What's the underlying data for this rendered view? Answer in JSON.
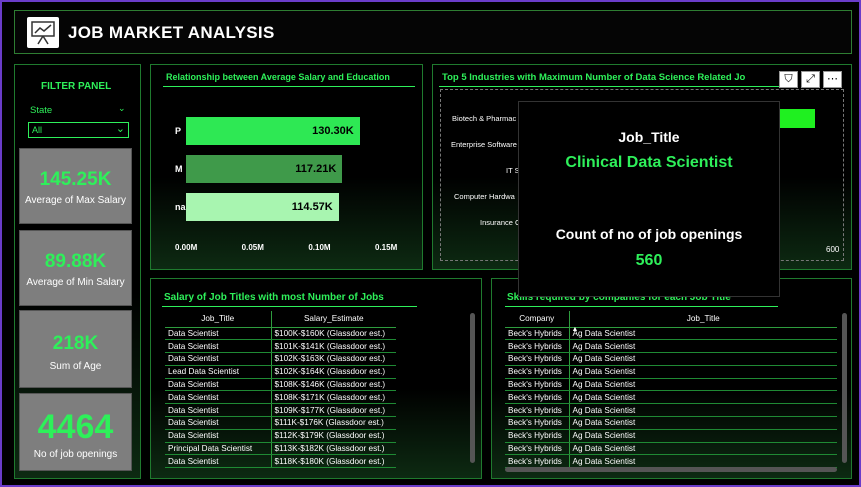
{
  "header": {
    "title": "JOB MARKET ANALYSIS",
    "logo_icon": "analytics-presentation-icon"
  },
  "filter": {
    "title": "FILTER PANEL",
    "state_label": "State",
    "state_value": "All"
  },
  "cards": [
    {
      "value": "145.25K",
      "label": "Average of Max Salary"
    },
    {
      "value": "89.88K",
      "label": "Average of Min Salary"
    },
    {
      "value": "218K",
      "label": "Sum of Age"
    },
    {
      "value": "4464",
      "label": "No of job openings"
    }
  ],
  "salary_edu": {
    "title": "Relationship between Average Salary and Education"
  },
  "chart_data": {
    "type": "bar",
    "orientation": "horizontal",
    "title": "Relationship between Average Salary and Education",
    "categories": [
      "P",
      "M",
      "na"
    ],
    "values": [
      130300,
      117210,
      114570
    ],
    "data_labels": [
      "130.30K",
      "117.21K",
      "114.57K"
    ],
    "xlim": [
      0,
      150000
    ],
    "x_ticks": [
      "0.00M",
      "0.05M",
      "0.10M",
      "0.15M"
    ],
    "colors": [
      "#2ee854",
      "#3f9a4a",
      "#a8f5b0"
    ]
  },
  "industries": {
    "title": "Top 5 Industries with Maximum Number of Data Science Related Jo",
    "labels": [
      "Biotech & Pharmac",
      "Enterprise Software",
      "IT S",
      "Computer Hardwa",
      "Insurance C"
    ],
    "axis_max": "600"
  },
  "tooltip": {
    "key1": "Job_Title",
    "val1": "Clinical Data Scientist",
    "key2": "Count of no of job openings",
    "val2": "560"
  },
  "salary_table": {
    "title": "Salary of Job Titles with most Number of Jobs",
    "columns": [
      "Job_Title",
      "Salary_Estimate"
    ],
    "rows": [
      [
        "Data Scientist",
        "$100K-$160K (Glassdoor est.)"
      ],
      [
        "Data Scientist",
        "$101K-$141K (Glassdoor est.)"
      ],
      [
        "Data Scientist",
        "$102K-$163K (Glassdoor est.)"
      ],
      [
        "Lead Data Scientist",
        "$102K-$164K (Glassdoor est.)"
      ],
      [
        "Data Scientist",
        "$108K-$146K (Glassdoor est.)"
      ],
      [
        "Data Scientist",
        "$108K-$171K (Glassdoor est.)"
      ],
      [
        "Data Scientist",
        "$109K-$177K (Glassdoor est.)"
      ],
      [
        "Data Scientist",
        "$111K-$176K (Glassdoor est.)"
      ],
      [
        "Data Scientist",
        "$112K-$179K (Glassdoor est.)"
      ],
      [
        "Principal Data Scientist",
        "$113K-$182K (Glassdoor est.)"
      ],
      [
        "Data Scientist",
        "$118K-$180K (Glassdoor est.)"
      ]
    ]
  },
  "skills_table": {
    "title": "Skills required by companies for each Job Title",
    "columns": [
      "Company",
      "Job_Title"
    ],
    "rows": [
      [
        "Beck's Hybrids",
        "Ag Data Scientist"
      ],
      [
        "Beck's Hybrids",
        "Ag Data Scientist"
      ],
      [
        "Beck's Hybrids",
        "Ag Data Scientist"
      ],
      [
        "Beck's Hybrids",
        "Ag Data Scientist"
      ],
      [
        "Beck's Hybrids",
        "Ag Data Scientist"
      ],
      [
        "Beck's Hybrids",
        "Ag Data Scientist"
      ],
      [
        "Beck's Hybrids",
        "Ag Data Scientist"
      ],
      [
        "Beck's Hybrids",
        "Ag Data Scientist"
      ],
      [
        "Beck's Hybrids",
        "Ag Data Scientist"
      ],
      [
        "Beck's Hybrids",
        "Ag Data Scientist"
      ],
      [
        "Beck's Hybrids",
        "Ag Data Scientist"
      ]
    ]
  },
  "colors": {
    "accent": "#2ef05a",
    "panel_border": "#1f7a2e",
    "card_bg": "#7e7e7e"
  }
}
